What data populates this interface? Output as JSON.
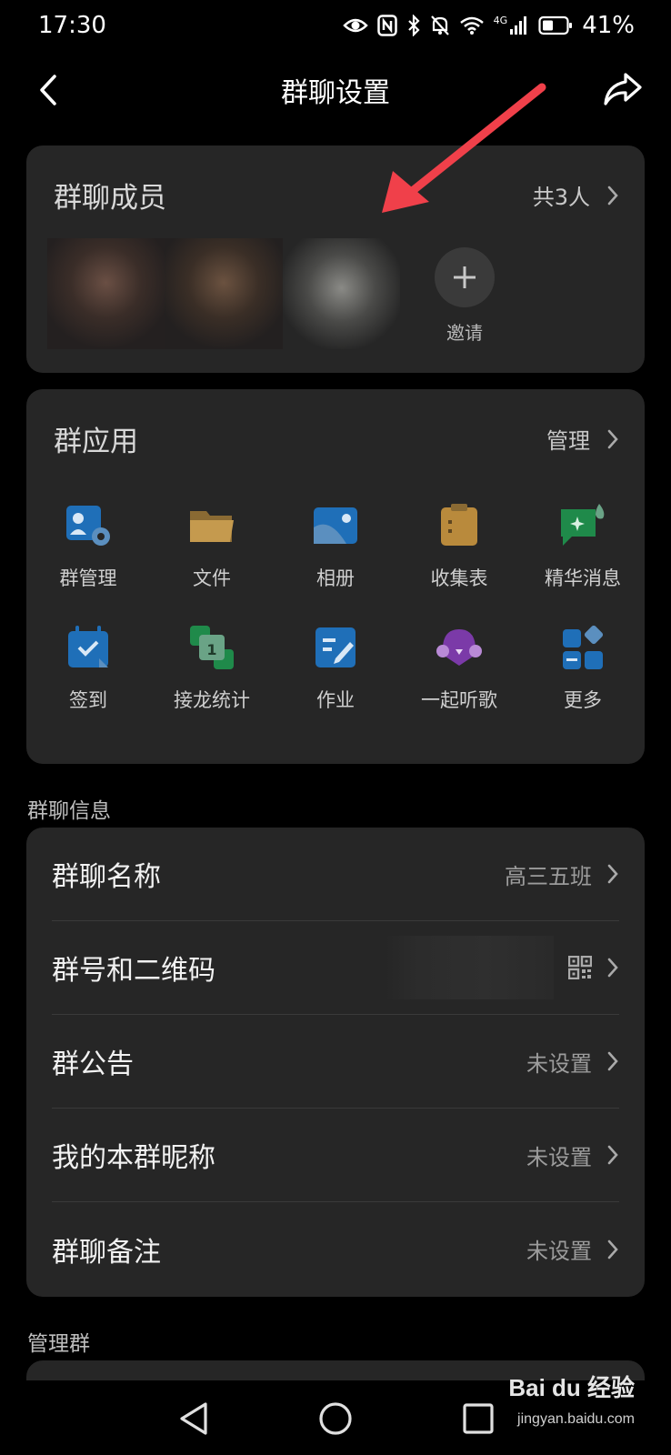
{
  "status_bar": {
    "time": "17:30",
    "network": "4G",
    "battery": "41%",
    "icons": [
      "eye-icon",
      "nfc-icon",
      "bluetooth-icon",
      "mute-icon",
      "wifi-icon",
      "signal-icon",
      "battery-icon"
    ]
  },
  "nav": {
    "title": "群聊设置",
    "back_icon": "chevron-left-icon",
    "share_icon": "share-icon"
  },
  "members": {
    "title": "群聊成员",
    "count_label": "共3人",
    "invite_label": "邀请"
  },
  "apps": {
    "title": "群应用",
    "manage_label": "管理",
    "items": [
      {
        "label": "群管理",
        "icon": "group-manage-icon"
      },
      {
        "label": "文件",
        "icon": "folder-icon"
      },
      {
        "label": "相册",
        "icon": "album-icon"
      },
      {
        "label": "收集表",
        "icon": "clipboard-icon"
      },
      {
        "label": "精华消息",
        "icon": "highlight-message-icon"
      },
      {
        "label": "签到",
        "icon": "calendar-check-icon"
      },
      {
        "label": "接龙统计",
        "icon": "relay-stats-icon"
      },
      {
        "label": "作业",
        "icon": "homework-icon"
      },
      {
        "label": "一起听歌",
        "icon": "listen-together-icon"
      },
      {
        "label": "更多",
        "icon": "more-apps-icon"
      }
    ]
  },
  "info": {
    "section_label": "群聊信息",
    "rows": [
      {
        "label": "群聊名称",
        "value": "高三五班"
      },
      {
        "label": "群号和二维码",
        "value": ""
      },
      {
        "label": "群公告",
        "value": "未设置"
      },
      {
        "label": "我的本群昵称",
        "value": "未设置"
      },
      {
        "label": "群聊备注",
        "value": "未设置"
      }
    ]
  },
  "manage": {
    "section_label": "管理群"
  },
  "watermark": {
    "brand": "Bai du 经验",
    "url": "jingyan.baidu.com"
  },
  "colors": {
    "background": "#000000",
    "card": "#262626",
    "annotation_arrow": "#f0404a"
  }
}
